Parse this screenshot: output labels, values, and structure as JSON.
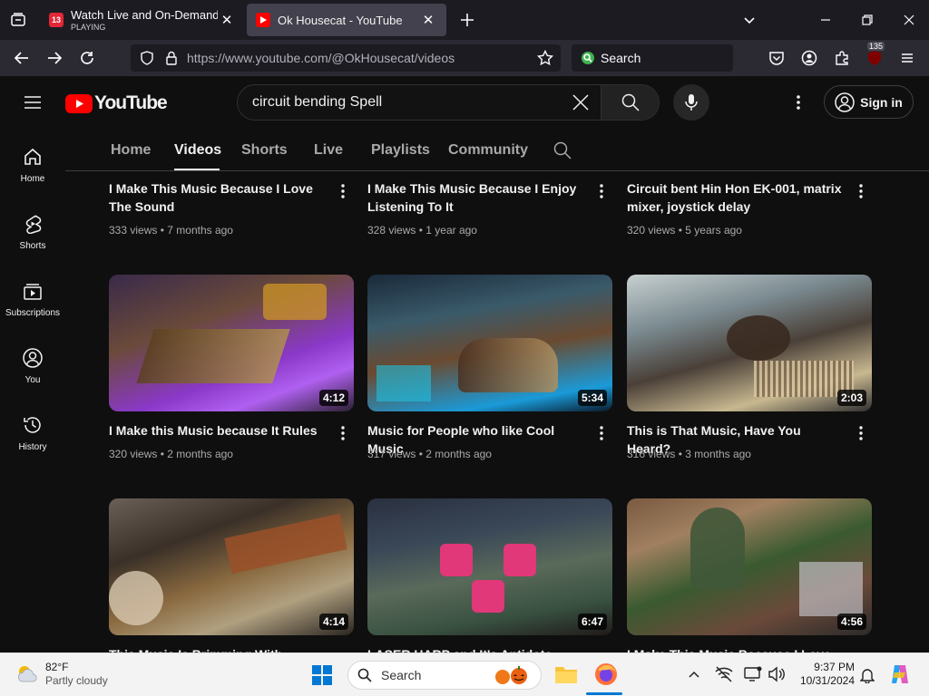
{
  "browser": {
    "tabs": [
      {
        "title": "Watch Live and On-Demand Vi",
        "subtitle": "PLAYING",
        "favicon_color": "#e32636",
        "favicon_text": "13"
      },
      {
        "title": "Ok Housecat - YouTube",
        "favicon_color": "#ff0000"
      }
    ],
    "url": "https://www.youtube.com/@OkHousecat/videos",
    "url_host": "youtube.com",
    "search_placeholder": "Search",
    "extension_badge": "135"
  },
  "youtube": {
    "logo_text": "YouTube",
    "search_value": "circuit bending Spell",
    "sign_in": "Sign in",
    "sidebar": [
      {
        "label": "Home",
        "icon": "home-icon"
      },
      {
        "label": "Shorts",
        "icon": "shorts-icon"
      },
      {
        "label": "Subscriptions",
        "icon": "subscriptions-icon"
      },
      {
        "label": "You",
        "icon": "you-icon"
      },
      {
        "label": "History",
        "icon": "history-icon"
      }
    ],
    "channel_tabs": [
      "Home",
      "Videos",
      "Shorts",
      "Live",
      "Playlists",
      "Community"
    ],
    "active_tab": "Videos",
    "videos": [
      {
        "title": "I Make This Music Because I Love The Sound",
        "views": "333 views",
        "age": "7 months ago"
      },
      {
        "title": "I Make This Music Because I Enjoy Listening To It",
        "views": "328 views",
        "age": "1 year ago"
      },
      {
        "title": "Circuit bent Hin Hon EK-001, matrix mixer, joystick delay",
        "views": "320 views",
        "age": "5 years ago"
      },
      {
        "title": "I Make this Music because It Rules",
        "views": "320 views",
        "age": "2 months ago",
        "duration": "4:12"
      },
      {
        "title": "Music for People who like Cool Music",
        "views": "317 views",
        "age": "2 months ago",
        "duration": "5:34"
      },
      {
        "title": "This is That Music, Have You Heard?",
        "views": "316 views",
        "age": "3 months ago",
        "duration": "2:03"
      },
      {
        "title": "This Music Is Brimming With Something",
        "duration": "4:14"
      },
      {
        "title": "LASER HARP and It's Antidote",
        "duration": "6:47"
      },
      {
        "title": "I Make This Music Because I Love",
        "duration": "4:56"
      }
    ],
    "meta_separator": "•"
  },
  "taskbar": {
    "temperature": "82°F",
    "weather": "Partly cloudy",
    "search": "Search",
    "time": "9:37 PM",
    "date": "10/31/2024"
  }
}
